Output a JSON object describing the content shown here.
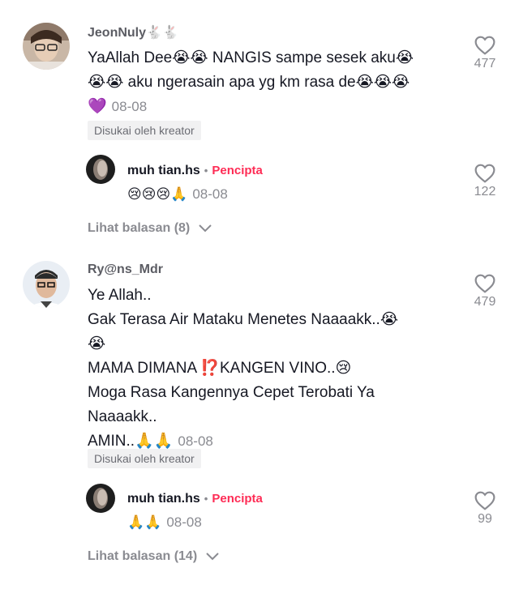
{
  "comments": [
    {
      "username": "JeonNuly🐇🐇",
      "lines": [
        "YaAllah Dee😭😭 NANGIS sampe sesek aku😭",
        "😭😭 aku ngerasain apa yg km rasa de😭😭😭"
      ],
      "last_line_emoji": "💜",
      "date": "08-08",
      "badge": "Disukai oleh kreator",
      "likes": "477",
      "reply": {
        "username": "muh tian.hs",
        "creator_label": "Pencipta",
        "text": "😢😢😢🙏",
        "date": "08-08",
        "likes": "122"
      },
      "view_replies": "Lihat balasan (8)"
    },
    {
      "username": "Ry@ns_Mdr",
      "lines": [
        "Ye Allah..",
        "Gak Terasa Air Mataku Menetes Naaaakk..😭",
        "😭",
        "MAMA DIMANA ⁉️KANGEN VINO..😢",
        "Moga Rasa Kangennya Cepet Terobati Ya",
        "Naaaakk.."
      ],
      "last_line_text": "AMIN..🙏🙏",
      "date": "08-08",
      "badge": "Disukai oleh kreator",
      "likes": "479",
      "reply": {
        "username": "muh tian.hs",
        "creator_label": "Pencipta",
        "text": "🙏🙏",
        "date": "08-08",
        "likes": "99"
      },
      "view_replies": "Lihat balasan (14)"
    }
  ],
  "icons": {
    "like": "heart-outline-icon",
    "expand": "chevron-down-icon"
  },
  "colors": {
    "creator": "#fe2c55",
    "secondary_text": "#8a8b91"
  }
}
